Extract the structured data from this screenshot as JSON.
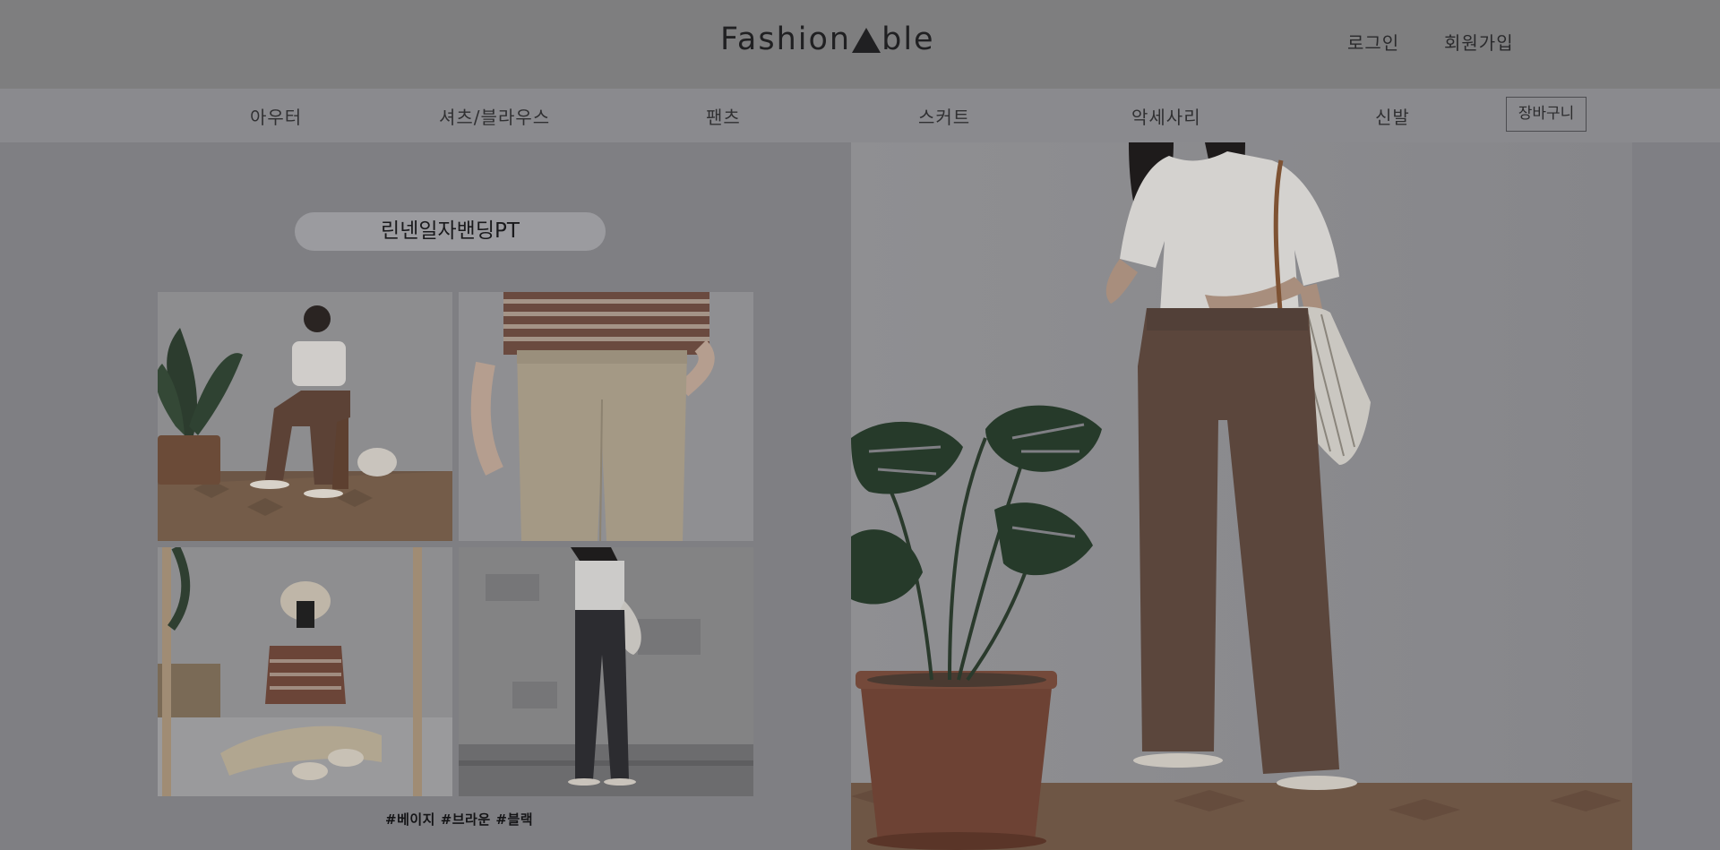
{
  "header": {
    "logo_left": "Fashion",
    "logo_right": "ble",
    "login": "로그인",
    "signup": "회원가입"
  },
  "nav": {
    "items": [
      {
        "label": "아우터"
      },
      {
        "label": "셔츠/블라우스"
      },
      {
        "label": "팬츠"
      },
      {
        "label": "스커트"
      },
      {
        "label": "악세사리"
      },
      {
        "label": "신발"
      }
    ],
    "cart": "장바구니"
  },
  "product": {
    "title": "린넨일자밴딩PT",
    "tags": "#베이지 #브라운 #블랙"
  },
  "icons": {
    "logo_mark": "triangle-a-icon"
  }
}
